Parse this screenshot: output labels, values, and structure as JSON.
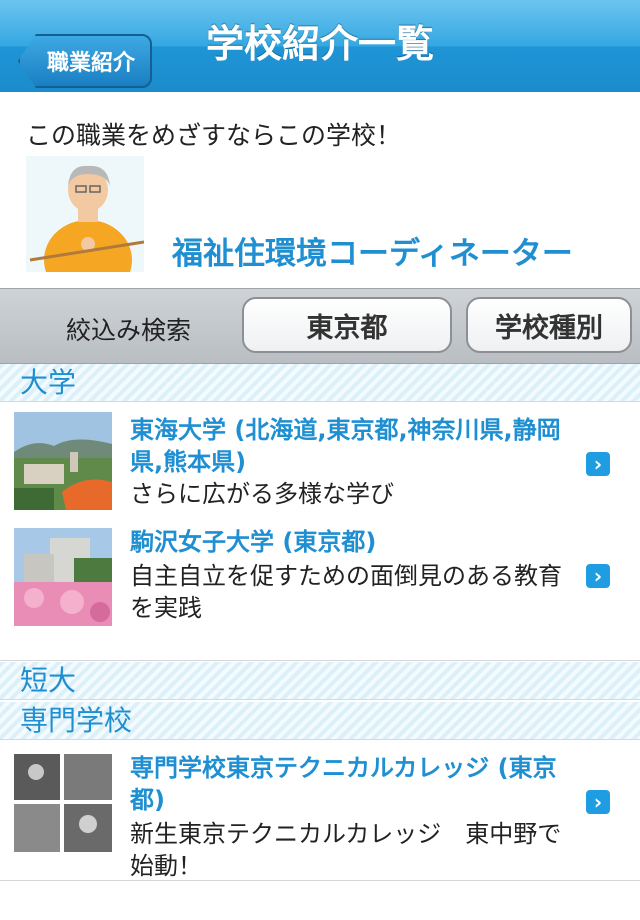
{
  "nav": {
    "back_label": "職業紹介",
    "title": "学校紹介一覧"
  },
  "intro": {
    "text": "この職業をめざすならこの学校！",
    "job_title": "福祉住環境コーディネーター"
  },
  "filter": {
    "label": "絞込み検索",
    "region": "東京都",
    "school_type": "学校種別"
  },
  "sections": {
    "university": "大学",
    "junior_college": "短大",
    "vocational": "専門学校"
  },
  "university_items": [
    {
      "title": "東海大学 (北海道,東京都,神奈川県,静岡県,熊本県)",
      "desc": "さらに広がる多様な学び"
    },
    {
      "title": "駒沢女子大学 (東京都)",
      "desc": "自主自立を促すための面倒見のある教育を実践"
    }
  ],
  "vocational_items": [
    {
      "title": "専門学校東京テクニカルカレッジ (東京都)",
      "desc": "新生東京テクニカルカレッジ　東中野で始動！"
    }
  ],
  "icons": {
    "chevron": "chevron-right-icon"
  },
  "colors": {
    "accent": "#1f8fd2",
    "navbar": "#34a8e2"
  }
}
